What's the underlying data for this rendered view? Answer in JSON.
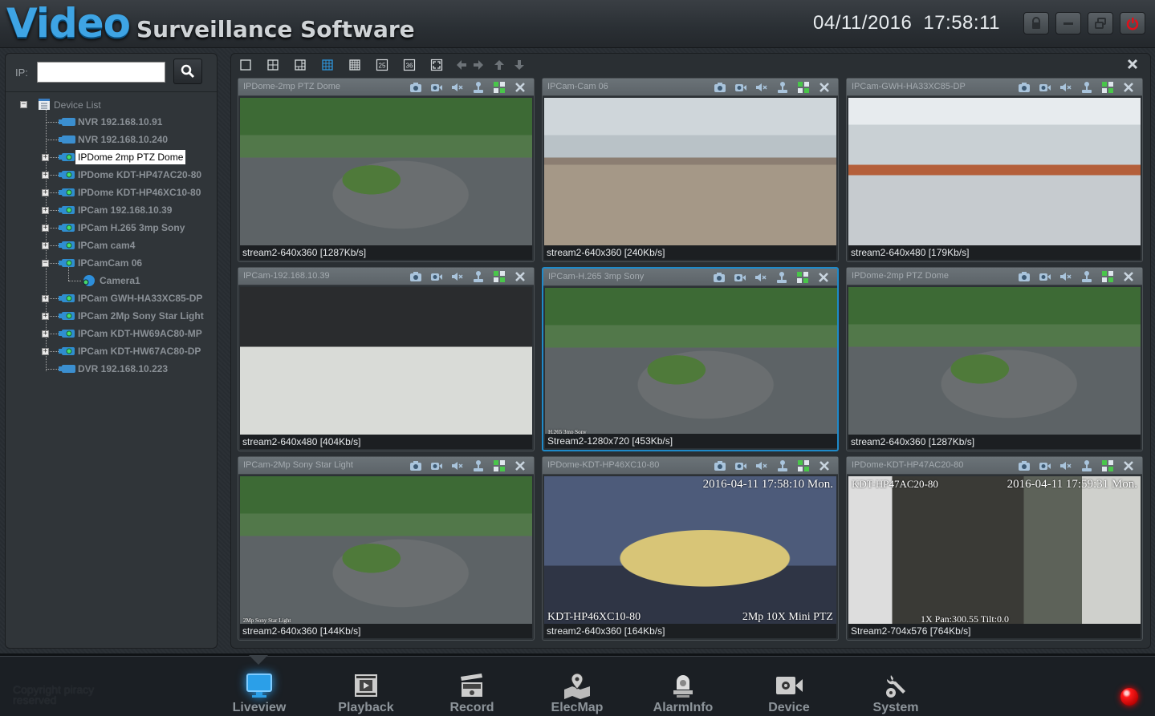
{
  "header": {
    "title_main": "Video",
    "title_sub": "Surveillance Software",
    "date": "04/11/2016",
    "time": "17:58:11",
    "window_buttons": [
      {
        "name": "lock",
        "icon": "lock-icon"
      },
      {
        "name": "minimize",
        "icon": "minimize-icon"
      },
      {
        "name": "restore",
        "icon": "restore-icon"
      },
      {
        "name": "power",
        "icon": "power-icon"
      }
    ],
    "colors": {
      "title_accent": "#3ea4e4",
      "power": "#e0101a"
    }
  },
  "sidebar": {
    "ip_label": "IP:",
    "ip_value": "",
    "search_icon": "search-icon",
    "tree_root": "Device List",
    "devices": [
      {
        "label": "NVR 192.168.10.91",
        "type": "nvr",
        "expandable": false
      },
      {
        "label": "NVR 192.168.10.240",
        "type": "nvr",
        "expandable": false
      },
      {
        "label": "IPDome 2mp PTZ Dome",
        "type": "ipcam",
        "expandable": true,
        "selected": true
      },
      {
        "label": "IPDome KDT-HP47AC20-80",
        "type": "ipcam",
        "expandable": true
      },
      {
        "label": "IPDome KDT-HP46XC10-80",
        "type": "ipcam",
        "expandable": true
      },
      {
        "label": "IPCam 192.168.10.39",
        "type": "ipcam",
        "expandable": true
      },
      {
        "label": "IPCam H.265 3mp Sony",
        "type": "ipcam",
        "expandable": true
      },
      {
        "label": "IPCam cam4",
        "type": "ipcam",
        "expandable": true
      },
      {
        "label": "IPCamCam 06",
        "type": "ipcam",
        "expandable": true,
        "expanded": true,
        "children": [
          {
            "label": "Camera1",
            "type": "camera"
          }
        ]
      },
      {
        "label": "IPCam GWH-HA33XC85-DP",
        "type": "ipcam",
        "expandable": true
      },
      {
        "label": "IPCam 2Mp Sony Star Light",
        "type": "ipcam",
        "expandable": true
      },
      {
        "label": "IPCam KDT-HW69AC80-MP",
        "type": "ipcam",
        "expandable": true
      },
      {
        "label": "IPCam KDT-HW67AC80-DP",
        "type": "ipcam",
        "expandable": true
      },
      {
        "label": "DVR 192.168.10.223",
        "type": "dvr",
        "expandable": false
      }
    ]
  },
  "toolbar": {
    "layouts": [
      "1",
      "4",
      "6",
      "9",
      "16",
      "25",
      "36"
    ],
    "active_layout": "9",
    "layout_25_label": "25",
    "layout_36_label": "36",
    "buttons": [
      "fullscreen-icon",
      "arrow-left-icon",
      "arrow-right-icon",
      "arrow-up-icon",
      "arrow-down-icon"
    ],
    "close_icon": "close-icon"
  },
  "tiles": [
    {
      "title": "IPDome-2mp PTZ Dome",
      "status": "stream2-640x360 [1287Kb/s]",
      "scene": "park",
      "active": false
    },
    {
      "title": "IPCam-Cam 06",
      "status": "stream2-640x360 [240Kb/s]",
      "scene": "office",
      "active": false
    },
    {
      "title": "IPCam-GWH-HA33XC85-DP",
      "status": "stream2-640x480 [179Kb/s]",
      "scene": "office2",
      "active": false
    },
    {
      "title": "IPCam-192.168.10.39",
      "status": "stream2-640x480 [404Kb/s]",
      "scene": "desk",
      "active": false
    },
    {
      "title": "IPCam-H.265 3mp Sony",
      "status": "Stream2-1280x720 [453Kb/s]",
      "scene": "park",
      "active": true,
      "osd_bottom_left": "H.265 3mp Sony"
    },
    {
      "title": "IPDome-2mp PTZ Dome",
      "status": "stream2-640x360 [1287Kb/s]",
      "scene": "park",
      "active": false
    },
    {
      "title": "IPCam-2Mp Sony Star Light",
      "status": "stream2-640x360 [144Kb/s]",
      "scene": "park",
      "active": false,
      "osd_bottom_left": "2Mp Sony Star Light"
    },
    {
      "title": "IPDome-KDT-HP46XC10-80",
      "status": "stream2-640x360 [164Kb/s]",
      "scene": "conf",
      "active": false,
      "osd_top_right": "2016-04-11 17:58:10 Mon.",
      "osd_bottom_left": "KDT-HP46XC10-80",
      "osd_bottom_right": "2Mp 10X Mini PTZ"
    },
    {
      "title": "IPDome-KDT-HP47AC20-80",
      "status": "Stream2-704x576 [764Kb/s]",
      "scene": "room",
      "active": false,
      "osd_top_left": "KDT-HP47AC20-80",
      "osd_top_right": "2016-04-11 17:59:31 Mon.",
      "osd_bottom": "1X  Pan:300.55  Tilt:0.0"
    }
  ],
  "tile_tools": [
    "snapshot-icon",
    "record-icon",
    "mute-icon",
    "ptz-icon",
    "layout-icon",
    "close-icon"
  ],
  "bottom_nav": {
    "copyright": "Copyright piracy reserved",
    "items": [
      {
        "label": "Liveview",
        "icon": "monitor-icon",
        "active": true
      },
      {
        "label": "Playback",
        "icon": "film-play-icon"
      },
      {
        "label": "Record",
        "icon": "clapperboard-icon"
      },
      {
        "label": "ElecMap",
        "icon": "map-pin-icon"
      },
      {
        "label": "AlarmInfo",
        "icon": "alarm-light-icon"
      },
      {
        "label": "Device",
        "icon": "camera-gear-icon"
      },
      {
        "label": "System",
        "icon": "wrench-gear-icon"
      }
    ],
    "status_led_color": "#ff1a1a"
  }
}
